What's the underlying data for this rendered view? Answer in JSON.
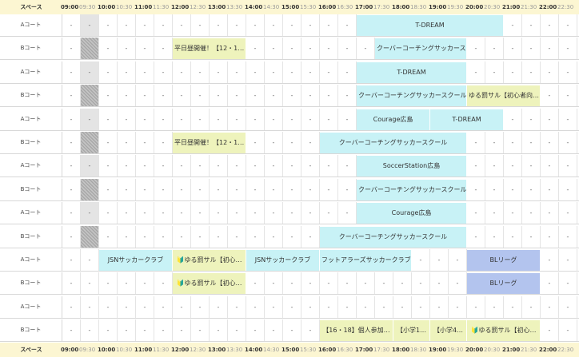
{
  "header": {
    "space_label": "スペース",
    "times": [
      "09:00",
      "09:30",
      "10:00",
      "10:30",
      "11:00",
      "11:30",
      "12:00",
      "12:30",
      "13:00",
      "13:30",
      "14:00",
      "14:30",
      "15:00",
      "15:30",
      "16:00",
      "16:30",
      "17:00",
      "17:30",
      "18:00",
      "18:30",
      "19:00",
      "19:30",
      "20:00",
      "20:30",
      "21:00",
      "21:30",
      "22:00",
      "22:30"
    ]
  },
  "colors": {
    "header_bg": "#fcf6d2",
    "cyan": "#c8f2f6",
    "yellow": "#eef3bc",
    "blue": "#b3c4ee",
    "closed": "#e4e4e4"
  },
  "empty_mark": "-",
  "rows": [
    {
      "court": "Aコート",
      "closed_slot": "-",
      "blocks": [
        {
          "start": "17:00",
          "end": "21:00",
          "label": "T-DREAM",
          "color": "cyan"
        }
      ]
    },
    {
      "court": "Bコート",
      "closed_slot": "hatched",
      "blocks": [
        {
          "start": "12:00",
          "end": "14:00",
          "label": "平日昼開催！【12・1…",
          "color": "yellow"
        },
        {
          "start": "17:30",
          "end": "20:00",
          "label": "クーバーコーチングサッカースクール",
          "color": "cyan"
        }
      ]
    },
    {
      "court": "Aコート",
      "closed_slot": "-",
      "blocks": [
        {
          "start": "17:00",
          "end": "20:00",
          "label": "T-DREAM",
          "color": "cyan"
        }
      ]
    },
    {
      "court": "Bコート",
      "closed_slot": "hatched",
      "blocks": [
        {
          "start": "17:00",
          "end": "20:00",
          "label": "クーバーコーチングサッカースクール",
          "color": "cyan"
        },
        {
          "start": "20:00",
          "end": "22:00",
          "label": "ゆる罰サル【初心者向…",
          "color": "yellow"
        }
      ]
    },
    {
      "court": "Aコート",
      "closed_slot": "-",
      "blocks": [
        {
          "start": "17:00",
          "end": "19:00",
          "label": "Courage広島",
          "color": "cyan"
        },
        {
          "start": "19:00",
          "end": "21:00",
          "label": "T-DREAM",
          "color": "cyan"
        }
      ]
    },
    {
      "court": "Bコート",
      "closed_slot": "hatched",
      "blocks": [
        {
          "start": "12:00",
          "end": "14:00",
          "label": "平日昼開催！【12・1…",
          "color": "yellow"
        },
        {
          "start": "16:00",
          "end": "20:00",
          "label": "クーバーコーチングサッカースクール",
          "color": "cyan"
        }
      ]
    },
    {
      "court": "Aコート",
      "closed_slot": "-",
      "blocks": [
        {
          "start": "17:00",
          "end": "20:00",
          "label": "SoccerStation広島",
          "color": "cyan"
        }
      ]
    },
    {
      "court": "Bコート",
      "closed_slot": "hatched",
      "blocks": [
        {
          "start": "17:00",
          "end": "20:00",
          "label": "クーバーコーチングサッカースクール",
          "color": "cyan"
        }
      ]
    },
    {
      "court": "Aコート",
      "closed_slot": "-",
      "blocks": [
        {
          "start": "17:00",
          "end": "20:00",
          "label": "Courage広島",
          "color": "cyan"
        }
      ]
    },
    {
      "court": "Bコート",
      "closed_slot": "hatched",
      "blocks": [
        {
          "start": "16:00",
          "end": "20:00",
          "label": "クーバーコーチングサッカースクール",
          "color": "cyan"
        }
      ]
    },
    {
      "court": "Aコート",
      "closed_slot": "",
      "blocks": [
        {
          "start": "10:00",
          "end": "12:00",
          "label": "JSNサッカークラブ",
          "color": "cyan"
        },
        {
          "start": "12:00",
          "end": "14:00",
          "label": "🔰ゆる罰サル【初心…",
          "color": "yellow"
        },
        {
          "start": "14:00",
          "end": "16:00",
          "label": "JSNサッカークラブ",
          "color": "cyan"
        },
        {
          "start": "16:00",
          "end": "18:30",
          "label": "フットアラーズサッカークラブ",
          "color": "cyan"
        },
        {
          "start": "20:00",
          "end": "22:00",
          "label": "BLリーグ",
          "color": "blue"
        }
      ]
    },
    {
      "court": "Bコート",
      "closed_slot": "",
      "blocks": [
        {
          "start": "12:00",
          "end": "14:00",
          "label": "🔰ゆる罰サル【初心…",
          "color": "yellow"
        },
        {
          "start": "20:00",
          "end": "22:00",
          "label": "BLリーグ",
          "color": "blue"
        }
      ]
    },
    {
      "court": "Aコート",
      "closed_slot": "",
      "blocks": []
    },
    {
      "court": "Bコート",
      "closed_slot": "",
      "blocks": [
        {
          "start": "16:00",
          "end": "18:00",
          "label": "【16・18】個人参加…",
          "color": "yellow"
        },
        {
          "start": "18:00",
          "end": "19:00",
          "label": "【小学1…",
          "color": "yellow"
        },
        {
          "start": "19:00",
          "end": "20:00",
          "label": "【小学4…",
          "color": "yellow"
        },
        {
          "start": "20:00",
          "end": "22:00",
          "label": "🔰ゆる罰サル【初心…",
          "color": "yellow"
        }
      ]
    }
  ]
}
